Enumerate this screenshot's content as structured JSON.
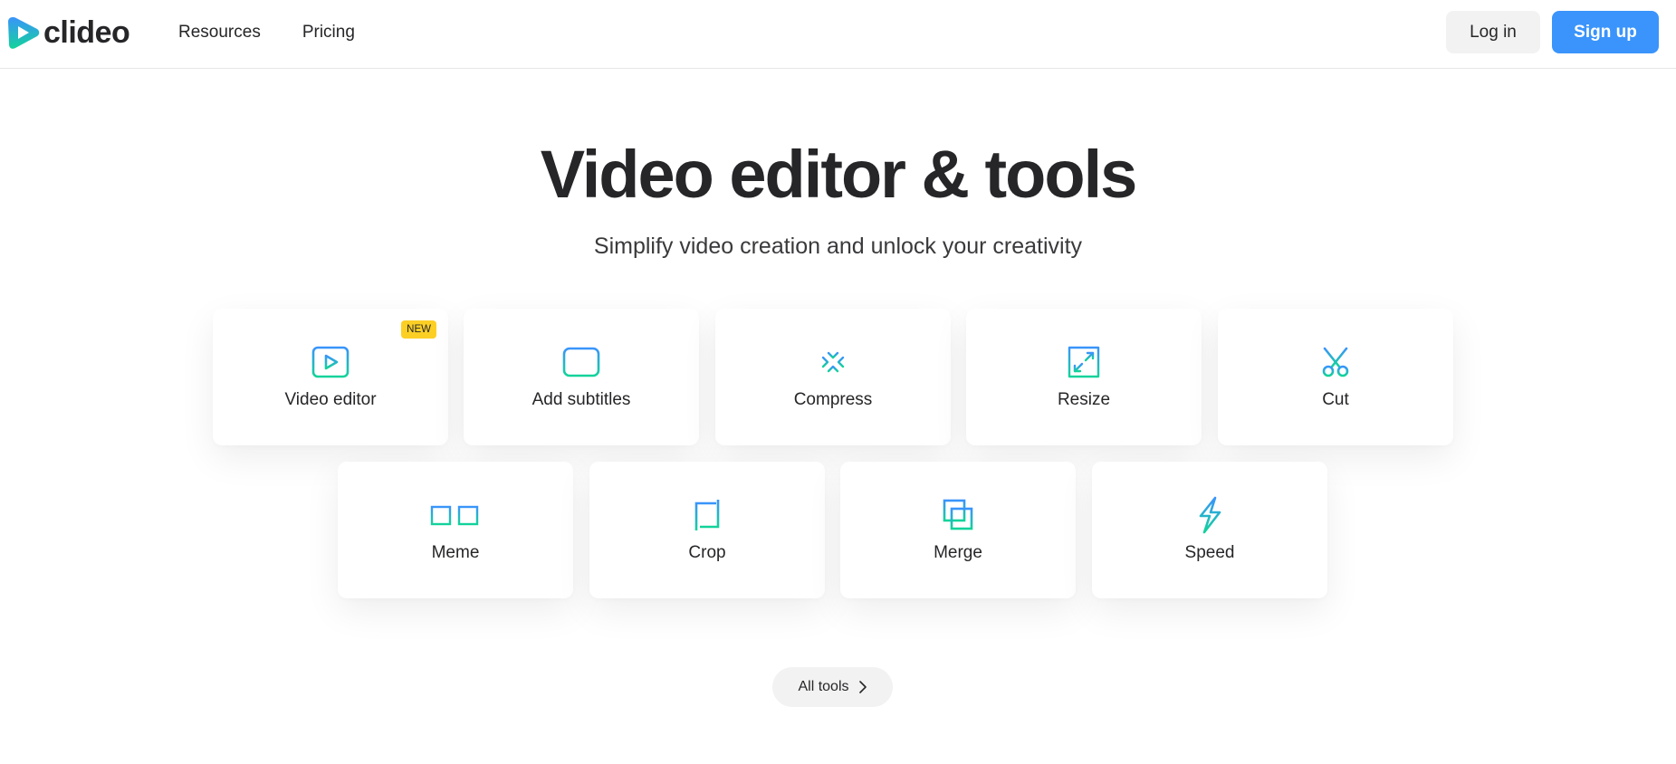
{
  "header": {
    "logo_text": "clideo",
    "nav": [
      {
        "label": "Resources"
      },
      {
        "label": "Pricing"
      }
    ],
    "login_label": "Log in",
    "signup_label": "Sign up"
  },
  "hero": {
    "title": "Video editor & tools",
    "subtitle": "Simplify video creation and unlock your creativity"
  },
  "tools": [
    {
      "label": "Video editor",
      "icon": "video-play-icon",
      "badge": "NEW"
    },
    {
      "label": "Add subtitles",
      "icon": "subtitles-icon"
    },
    {
      "label": "Compress",
      "icon": "compress-arrows-icon"
    },
    {
      "label": "Resize",
      "icon": "resize-arrows-icon"
    },
    {
      "label": "Cut",
      "icon": "scissors-icon"
    },
    {
      "label": "Meme",
      "icon": "glasses-icon"
    },
    {
      "label": "Crop",
      "icon": "crop-icon"
    },
    {
      "label": "Merge",
      "icon": "merge-squares-icon"
    },
    {
      "label": "Speed",
      "icon": "lightning-bolt-icon"
    }
  ],
  "all_tools_label": "All tools",
  "colors": {
    "accent_blue": "#3a94fb",
    "icon_gradient_top": "#3a94fb",
    "icon_gradient_bottom": "#12d39a",
    "badge_yellow": "#fccf24",
    "text_dark": "#262629"
  }
}
